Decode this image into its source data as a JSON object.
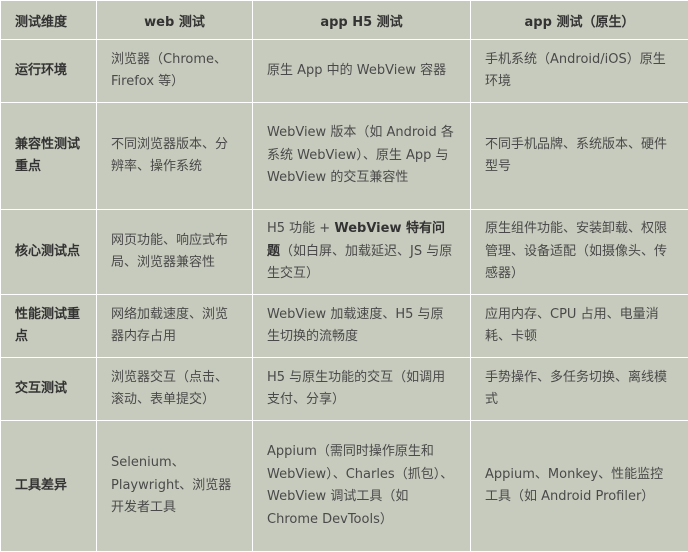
{
  "table": {
    "headers": [
      "测试维度",
      "web 测试",
      "app H5 测试",
      "app 测试（原生）"
    ],
    "rows": [
      {
        "dimension": "运行环境",
        "web": "浏览器（Chrome、Firefox 等）",
        "h5": "原生 App 中的 WebView 容器",
        "native": "手机系统（Android/iOS）原生环境"
      },
      {
        "dimension": "兼容性测试重点",
        "web": "不同浏览器版本、分辨率、操作系统",
        "h5": "WebView 版本（如 Android 各系统 WebView）、原生 App 与 WebView 的交互兼容性",
        "native": "不同手机品牌、系统版本、硬件型号"
      },
      {
        "dimension": "核心测试点",
        "web": "网页功能、响应式布局、浏览器兼容性",
        "h5_prefix": "H5 功能 + ",
        "h5_bold": "WebView 特有问题",
        "h5_suffix": "（如白屏、加载延迟、JS 与原生交互）",
        "native": "原生组件功能、安装卸载、权限管理、设备适配（如摄像头、传感器）"
      },
      {
        "dimension": "性能测试重点",
        "web": "网络加载速度、浏览器内存占用",
        "h5": "WebView 加载速度、H5 与原生切换的流畅度",
        "native": "应用内存、CPU 占用、电量消耗、卡顿"
      },
      {
        "dimension": "交互测试",
        "web": "浏览器交互（点击、滚动、表单提交）",
        "h5": "H5 与原生功能的交互（如调用支付、分享）",
        "native": "手势操作、多任务切换、离线模式"
      },
      {
        "dimension": "工具差异",
        "web": "Selenium、Playwright、浏览器开发者工具",
        "h5": "Appium（需同时操作原生和 WebView）、Charles（抓包）、WebView 调试工具（如 Chrome DevTools）",
        "native": "Appium、Monkey、性能监控工具（如 Android Profiler）"
      }
    ]
  }
}
